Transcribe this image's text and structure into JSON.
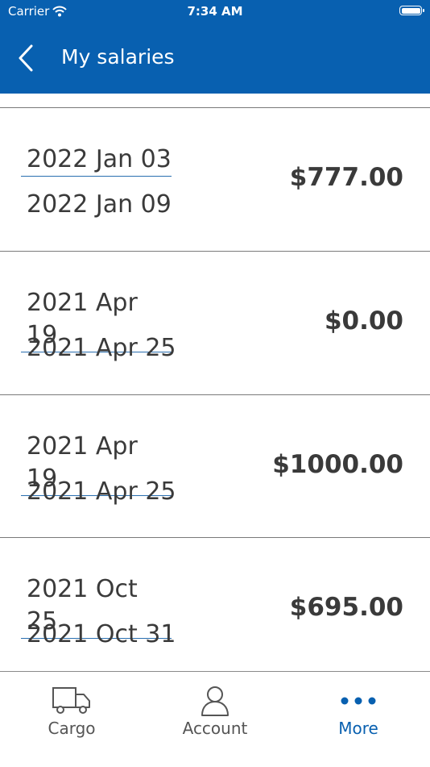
{
  "status_bar": {
    "carrier": "Carrier",
    "time": "7:34 AM"
  },
  "header": {
    "title": "My salaries"
  },
  "salaries": [
    {
      "start": "2022 Jan 03",
      "end": "2022 Jan 09",
      "amount": "$777.00"
    },
    {
      "start": "2021 Apr 19",
      "end": "2021 Apr 25",
      "amount": "$0.00"
    },
    {
      "start": "2021 Apr 19",
      "end": "2021 Apr 25",
      "amount": "$1000.00"
    },
    {
      "start": "2021 Oct 25",
      "end": "2021 Oct 31",
      "amount": "$695.00"
    }
  ],
  "tabbar": {
    "tabs": [
      {
        "label": "Cargo",
        "icon": "truck-icon"
      },
      {
        "label": "Account",
        "icon": "person-icon"
      },
      {
        "label": "More",
        "icon": "more-dots-icon",
        "active": true
      }
    ]
  },
  "colors": {
    "primary": "#0860b0",
    "text": "#3a3a3a",
    "divider": "#7a7a7a"
  }
}
